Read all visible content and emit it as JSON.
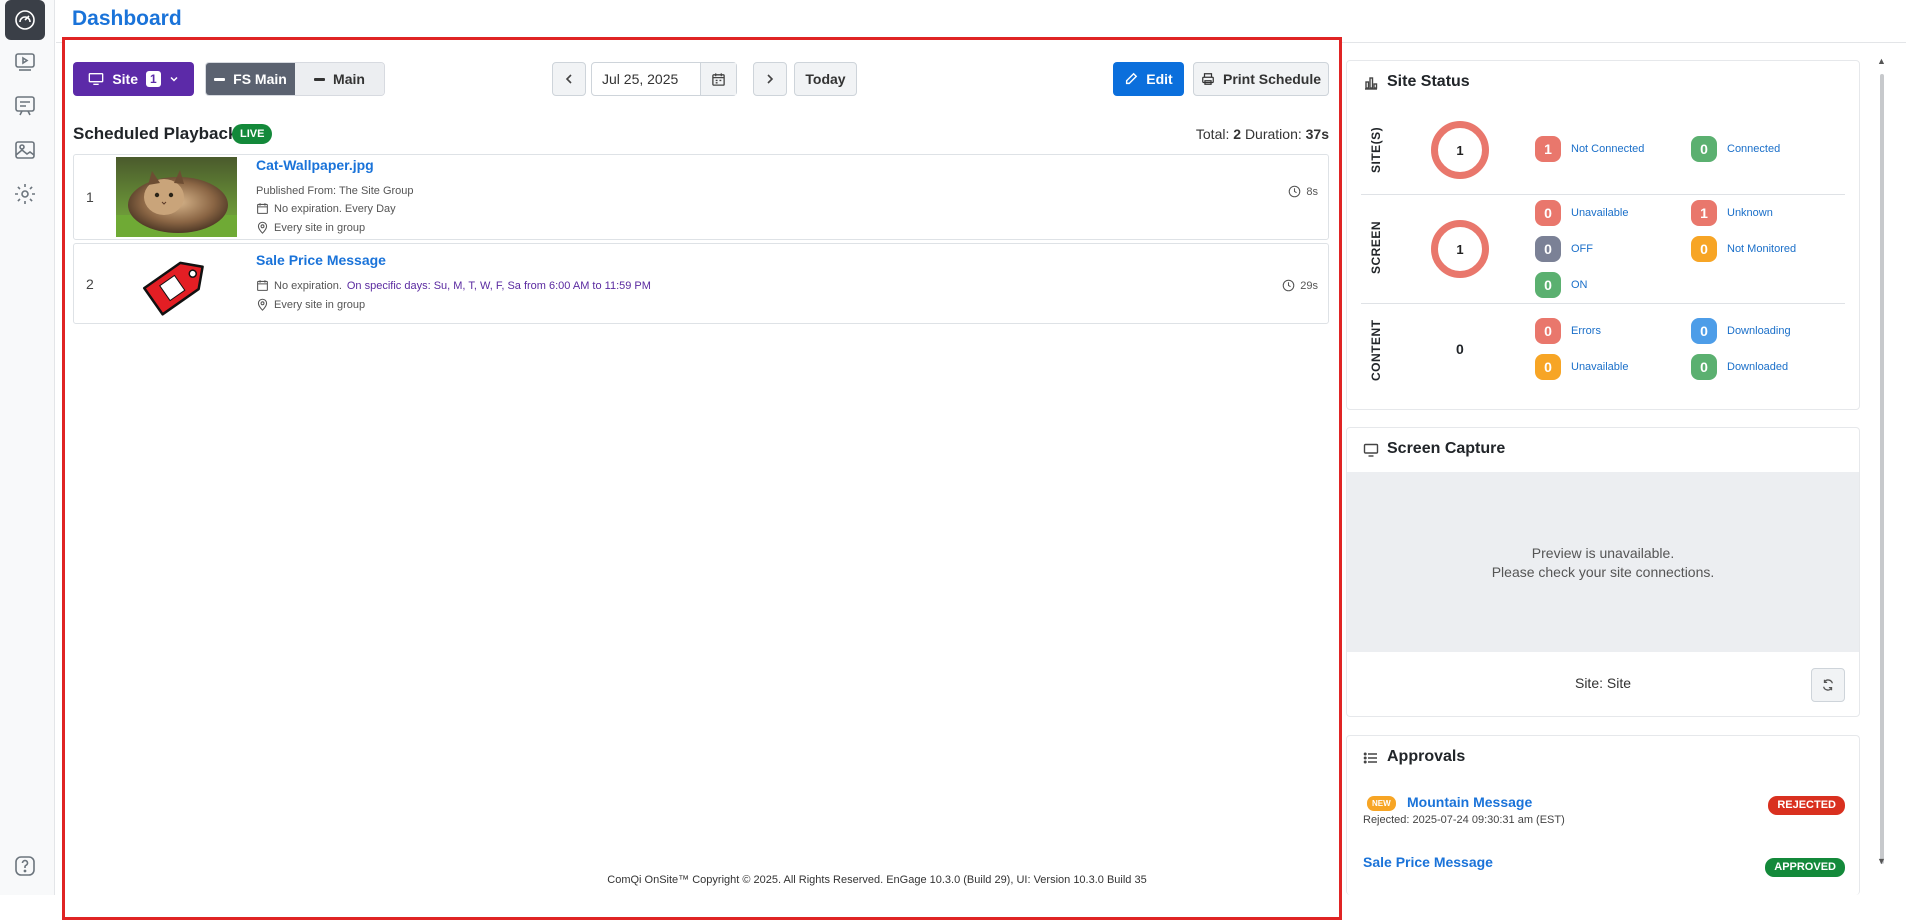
{
  "header": {
    "title": "Dashboard"
  },
  "toolbar": {
    "site_label": "Site",
    "site_count": "1",
    "seg_fs_main": "FS Main",
    "seg_main": "Main",
    "date": "Jul 25, 2025",
    "today": "Today",
    "edit": "Edit",
    "print": "Print Schedule"
  },
  "schedule": {
    "title": "Scheduled Playback",
    "live": "LIVE",
    "total_label": "Total:",
    "total_value": "2",
    "duration_label": "Duration:",
    "duration_value": "37s",
    "rows": [
      {
        "num": "1",
        "title": "Cat-Wallpaper.jpg",
        "published": "Published From: The Site Group",
        "expiration": "No expiration. Every Day",
        "location": "Every site in group",
        "duration": "8s"
      },
      {
        "num": "2",
        "title": "Sale Price Message",
        "expiration": "No expiration.",
        "schedule": "On specific days: Su, M, T, W, F, Sa from 6:00 AM to 11:59 PM",
        "location": "Every site in group",
        "duration": "29s"
      }
    ]
  },
  "footer": {
    "copyright": "ComQi OnSite™ Copyright © 2025. All Rights Reserved. EnGage 10.3.0 (Build 29), UI: Version 10.3.0 Build 35"
  },
  "site_status": {
    "title": "Site Status",
    "sites": {
      "label": "SITE(S)",
      "ring": "1",
      "stats": [
        {
          "value": "1",
          "label": "Not Connected",
          "color": "#e9776c"
        },
        {
          "value": "0",
          "label": "Connected",
          "color": "#5bb070"
        }
      ]
    },
    "screen": {
      "label": "SCREEN",
      "ring": "1",
      "stats": [
        {
          "value": "0",
          "label": "Unavailable",
          "color": "#e9776c"
        },
        {
          "value": "1",
          "label": "Unknown",
          "color": "#e9776c"
        },
        {
          "value": "0",
          "label": "OFF",
          "color": "#7b8196"
        },
        {
          "value": "0",
          "label": "Not Monitored",
          "color": "#f7a525"
        },
        {
          "value": "0",
          "label": "ON",
          "color": "#5bb070"
        }
      ]
    },
    "content": {
      "label": "CONTENT",
      "count": "0",
      "stats": [
        {
          "value": "0",
          "label": "Errors",
          "color": "#e9776c"
        },
        {
          "value": "0",
          "label": "Downloading",
          "color": "#4d9de8"
        },
        {
          "value": "0",
          "label": "Unavailable",
          "color": "#f7a525"
        },
        {
          "value": "0",
          "label": "Downloaded",
          "color": "#5bb070"
        }
      ]
    }
  },
  "screen_capture": {
    "title": "Screen Capture",
    "preview_line1": "Preview is unavailable.",
    "preview_line2": "Please check your site connections.",
    "site": "Site: Site"
  },
  "approvals": {
    "title": "Approvals",
    "items": [
      {
        "badge": "NEW",
        "title": "Mountain Message",
        "sub": "Rejected: 2025-07-24 09:30:31 am (EST)",
        "status": "REJECTED",
        "status_color": "#d9301f"
      },
      {
        "title": "Sale Price Message",
        "status": "APPROVED",
        "status_color": "#13893a"
      }
    ]
  },
  "rail": {
    "help": "?"
  },
  "icons": [
    "dashboard-icon",
    "playlist-icon",
    "messages-icon",
    "media-icon",
    "settings-icon",
    "help-icon",
    "calendar-icon",
    "clock-icon",
    "location-icon",
    "monitor-icon",
    "bar-chart-icon",
    "list-icon",
    "refresh-icon",
    "print-icon",
    "pencil-icon"
  ]
}
